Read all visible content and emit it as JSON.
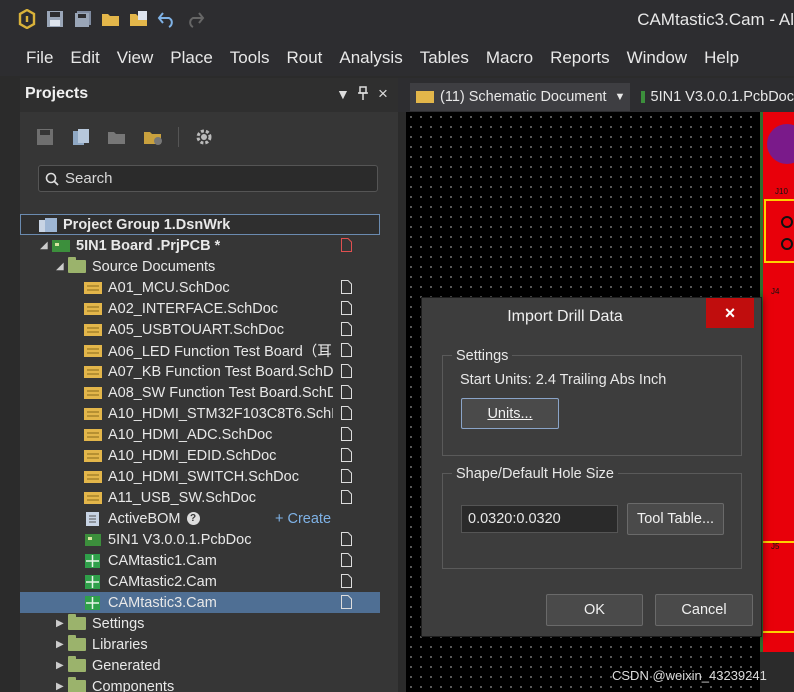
{
  "window": {
    "title": "CAMtastic3.Cam - Al"
  },
  "menu": [
    "File",
    "Edit",
    "View",
    "Place",
    "Tools",
    "Rout",
    "Analysis",
    "Tables",
    "Macro",
    "Reports",
    "Window",
    "Help"
  ],
  "panel": {
    "title": "Projects",
    "controls": {
      "dropdown": "▼",
      "pin": "₹",
      "close": "×"
    },
    "search_placeholder": "Search"
  },
  "tree": {
    "group": "Project Group 1.DsnWrk",
    "project": "5IN1 Board .PrjPCB *",
    "source_folder": "Source Documents",
    "schdocs": [
      "A01_MCU.SchDoc",
      "A02_INTERFACE.SchDoc",
      "A05_USBTOUART.SchDoc",
      "A06_LED Function Test Board（耳",
      "A07_KB Function Test Board.SchD",
      "A08_SW Function Test Board.SchD",
      "A10_HDMI_STM32F103C8T6.SchD",
      "A10_HDMI_ADC.SchDoc",
      "A10_HDMI_EDID.SchDoc",
      "A10_HDMI_SWITCH.SchDoc",
      "A11_USB_SW.SchDoc"
    ],
    "activebom": "ActiveBOM",
    "create": "+ Create",
    "pcbdoc": "5IN1 V3.0.0.1.PcbDoc",
    "cams": [
      "CAMtastic1.Cam",
      "CAMtastic2.Cam",
      "CAMtastic3.Cam"
    ],
    "folders": [
      "Settings",
      "Libraries",
      "Generated",
      "Components"
    ]
  },
  "doc_tabs": [
    "(11) Schematic Document",
    "5IN1 V3.0.0.1.PcbDoc"
  ],
  "dialog": {
    "title": "Import Drill Data",
    "close": "×",
    "settings_label": "Settings",
    "start_units": "Start Units: 2.4 Trailing Abs Inch",
    "units_button": "Units...",
    "shape_label": "Shape/Default Hole Size",
    "hole_size": "0.0320:0.0320",
    "tool_table_button": "Tool Table...",
    "ok": "OK",
    "cancel": "Cancel"
  },
  "pcb_labels": [
    "J10",
    "J4",
    "J5"
  ],
  "watermark": "CSDN @weixin_43239241",
  "colors": {
    "accent": "#4f6f94",
    "close": "#c00d0d",
    "pcb": "#e8000a",
    "folder": "#9bb36c"
  }
}
